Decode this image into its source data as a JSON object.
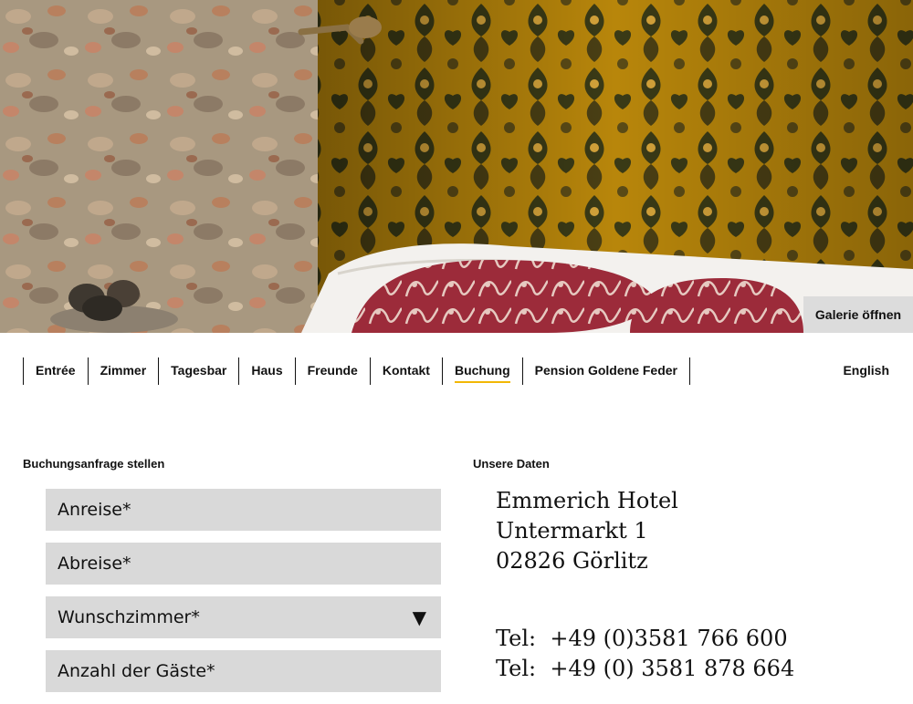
{
  "hero": {
    "gallery_button": "Galerie öffnen"
  },
  "nav": {
    "items": [
      {
        "label": "Entrée"
      },
      {
        "label": "Zimmer"
      },
      {
        "label": "Tagesbar"
      },
      {
        "label": "Haus"
      },
      {
        "label": "Freunde"
      },
      {
        "label": "Kontakt"
      },
      {
        "label": "Buchung",
        "active": true
      },
      {
        "label": "Pension Goldene Feder"
      }
    ],
    "language": "English",
    "active_color": "#f2b705"
  },
  "booking": {
    "heading": "Buchungsanfrage stellen",
    "fields": {
      "arrival": "Anreise*",
      "departure": "Abreise*",
      "room": "Wunschzimmer*",
      "guests": "Anzahl der Gäste*"
    },
    "dropdown_glyph": "▼"
  },
  "contact": {
    "heading": "Unsere Daten",
    "name": "Emmerich Hotel",
    "street": "Untermarkt 1",
    "city": "02826 Görlitz",
    "phone1": "Tel:  +49 (0)3581 766 600",
    "phone2": "Tel:  +49 (0) 3581 878 664"
  }
}
